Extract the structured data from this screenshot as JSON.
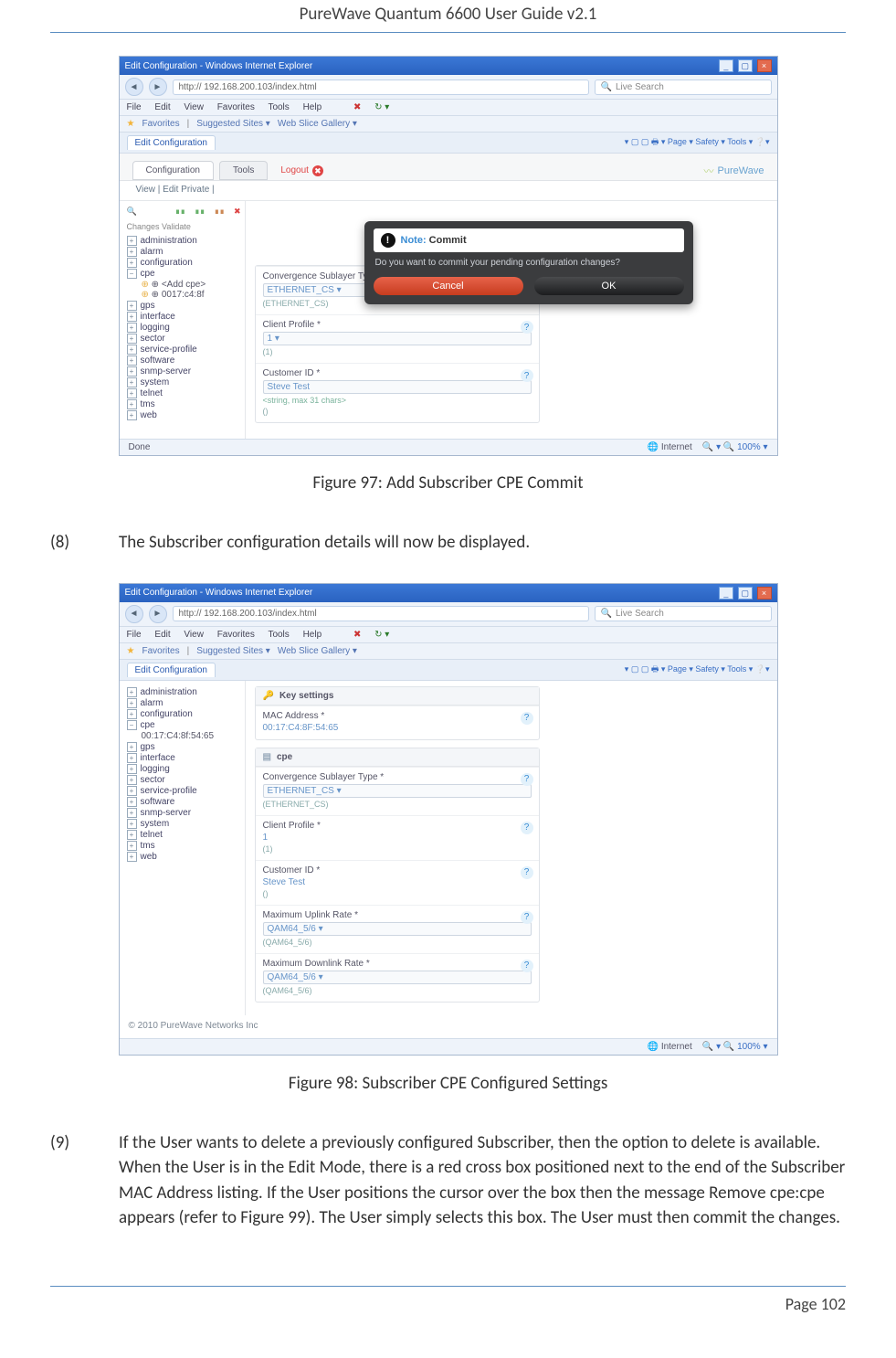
{
  "header": "PureWave Quantum 6600 User Guide v2.1",
  "footer": "Page 102",
  "fig1": {
    "caption": "Figure 97: Add Subscriber CPE Commit",
    "window_title": "Edit Configuration - Windows Internet Explorer",
    "url": "http:// 192.168.200.103/index.html",
    "search_placeholder": "Live Search",
    "menus": [
      "File",
      "Edit",
      "View",
      "Favorites",
      "Tools",
      "Help"
    ],
    "fav_label": "Favorites",
    "fav_links": [
      "Suggested Sites ▾",
      "Web Slice Gallery ▾"
    ],
    "tab_label": "Edit Configuration",
    "rtools": "▾ ▢ ▢ 🖶 ▾ Page ▾ Safety ▾ Tools ▾ ❔▾",
    "app_tabs": [
      "Configuration",
      "Tools"
    ],
    "logout": "Logout",
    "logo": "PureWave",
    "sub_nav": "View | Edit Private |",
    "toolbar_lbls": "Changes     Validate",
    "tree": [
      "administration",
      "alarm",
      "configuration",
      "cpe",
      "gps",
      "interface",
      "logging",
      "sector",
      "service-profile",
      "software",
      "snmp-server",
      "system",
      "telnet",
      "tms",
      "web"
    ],
    "tree_cpe_sub": [
      "⊕ <Add cpe>",
      "⊕ 0017:c4:8f"
    ],
    "field1_label": "Convergence Sublayer Type *",
    "field1_val": "ETHERNET_CS ▾",
    "field1_hint": "(ETHERNET_CS)",
    "field2_label": "Client Profile *",
    "field2_val": "1   ▾",
    "field2_hint": "(1)",
    "field3_label": "Customer ID *",
    "field3_val": "Steve Test",
    "field3_hint": "<string, max 31 chars>",
    "field3_hint2": "()",
    "modal_note": "Note:",
    "modal_title": "Commit",
    "modal_msg": "Do you want to commit your pending configuration changes?",
    "modal_cancel": "Cancel",
    "modal_ok": "OK",
    "status_left": "Done",
    "status_mid": "Internet",
    "status_zoom": "🔍 ▾ 🔍 100% ▾"
  },
  "step8": {
    "num": "(8)",
    "text": "The Subscriber configuration details will now be displayed."
  },
  "fig2": {
    "caption": "Figure 98: Subscriber CPE Configured Settings",
    "window_title": "Edit Configuration - Windows Internet Explorer",
    "url": "http:// 192.168.200.103/index.html",
    "search_placeholder": "Live Search",
    "menus": [
      "File",
      "Edit",
      "View",
      "Favorites",
      "Tools",
      "Help"
    ],
    "fav_label": "Favorites",
    "fav_links": [
      "Suggested Sites ▾",
      "Web Slice Gallery ▾"
    ],
    "tab_label": "Edit Configuration",
    "rtools": "▾ ▢ ▢ 🖶 ▾ Page ▾ Safety ▾ Tools ▾ ❔▾",
    "tree": [
      "administration",
      "alarm",
      "configuration",
      "cpe",
      "gps",
      "interface",
      "logging",
      "sector",
      "service-profile",
      "software",
      "snmp-server",
      "system",
      "telnet",
      "tms",
      "web"
    ],
    "tree_cpe_sub_single": "00:17:C4:8f:54:65",
    "panel1_head": "Key settings",
    "f_mac_label": "MAC Address *",
    "f_mac_val": "00:17:C4:8F:54:65",
    "panel2_head": "cpe",
    "f_cst_label": "Convergence Sublayer Type *",
    "f_cst_val": "ETHERNET_CS ▾",
    "f_cst_hint": "(ETHERNET_CS)",
    "f_cp_label": "Client Profile *",
    "f_cp_val": "1",
    "f_cp_hint": "(1)",
    "f_cid_label": "Customer ID *",
    "f_cid_val": "Steve Test",
    "f_cid_hint": "()",
    "f_mur_label": "Maximum Uplink Rate *",
    "f_mur_val": "QAM64_5/6 ▾",
    "f_mur_hint": "(QAM64_5/6)",
    "f_mdr_label": "Maximum Downlink Rate *",
    "f_mdr_val": "QAM64_5/6 ▾",
    "f_mdr_hint": "(QAM64_5/6)",
    "copyright": "© 2010 PureWave Networks Inc",
    "status_mid": "Internet",
    "status_zoom": "🔍 ▾ 🔍 100% ▾"
  },
  "step9": {
    "num": "(9)",
    "text": "If the User wants to delete a previously configured Subscriber, then the option to delete is available. When the User is in the Edit Mode, there is a red cross box positioned next to the end of the Subscriber MAC Address listing. If the User positions the cursor over the box then the message Remove cpe:cpe appears (refer to Figure 99). The User simply selects this box. The User must then commit the changes."
  }
}
